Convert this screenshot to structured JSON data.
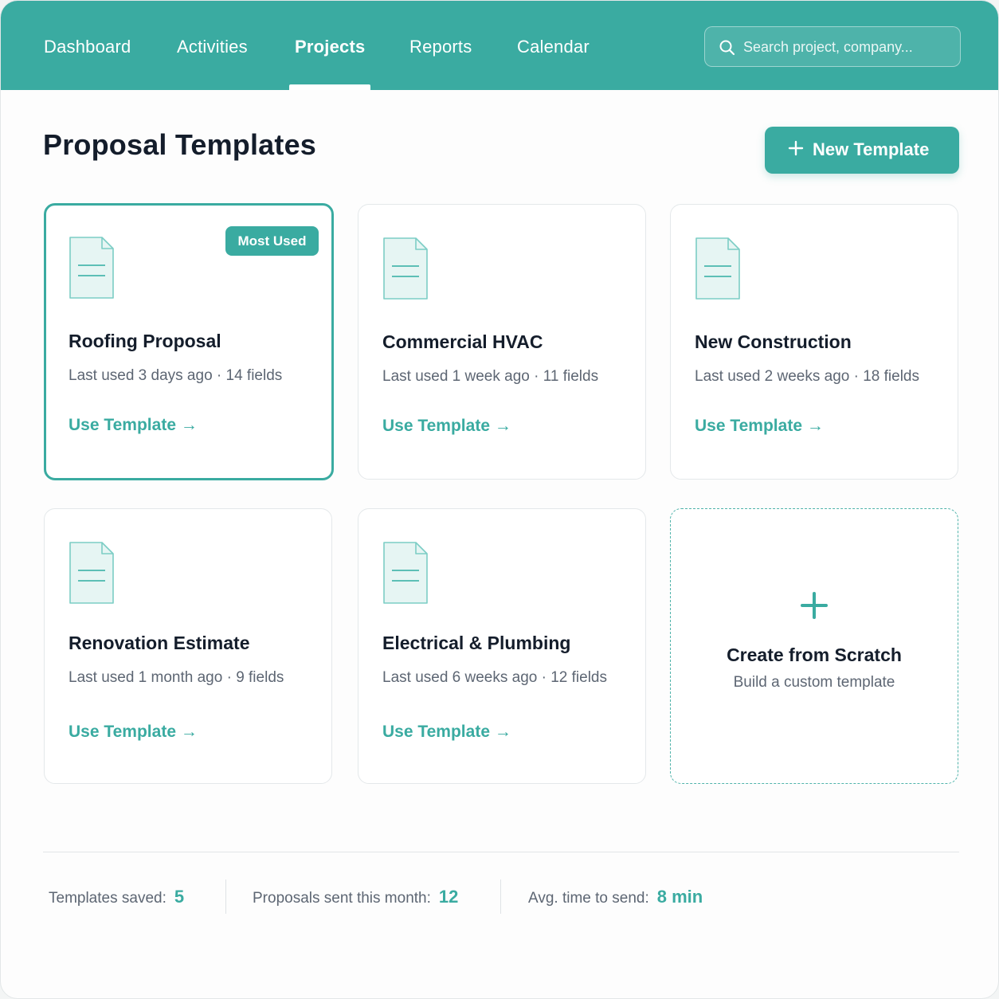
{
  "nav": {
    "items": [
      {
        "label": "Dashboard"
      },
      {
        "label": "Activities"
      },
      {
        "label": "Projects",
        "active": true
      },
      {
        "label": "Reports"
      },
      {
        "label": "Calendar"
      }
    ],
    "search_placeholder": "Search project, company..."
  },
  "page": {
    "title": "Proposal Templates",
    "new_button_label": "New Template"
  },
  "templates": [
    {
      "title": "Roofing Proposal",
      "meta": "Last used 3 days ago · 14 fields",
      "action": "Use Template →",
      "badge": "Most Used"
    },
    {
      "title": "Commercial HVAC",
      "meta": "Last used 1 week ago · 11 fields",
      "action": "Use Template →"
    },
    {
      "title": "New Construction",
      "meta": "Last used 2 weeks ago · 18 fields",
      "action": "Use Template →"
    },
    {
      "title": "Renovation Estimate",
      "meta": "Last used 1 month ago · 9 fields",
      "action": "Use Template →"
    },
    {
      "title": "Electrical & Plumbing",
      "meta": "Last used 6 weeks ago · 12 fields",
      "action": "Use Template →"
    }
  ],
  "scratch": {
    "title": "Create from Scratch",
    "subtitle": "Build a custom template"
  },
  "stats": [
    {
      "label": "Templates saved:",
      "value": "5"
    },
    {
      "label": "Proposals sent this month:",
      "value": "12"
    },
    {
      "label": "Avg. time to send:",
      "value": "8 min"
    }
  ],
  "colors": {
    "accent": "#3aaba1",
    "heading": "#141d2b",
    "muted": "#5d6673"
  }
}
